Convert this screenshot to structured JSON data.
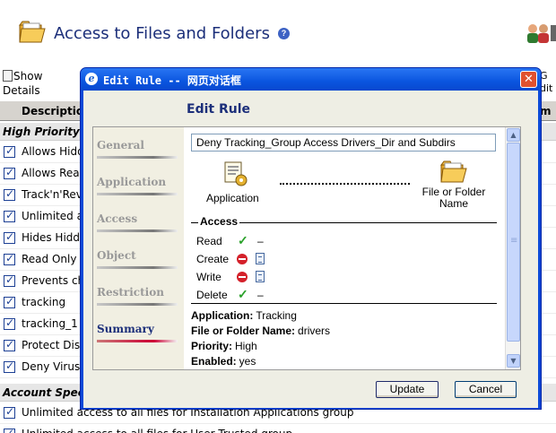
{
  "page": {
    "title": "Access to Files and Folders",
    "toolbar": {
      "show_details_line1": "Show",
      "show_details_line2": "Details",
      "right_edit_line1": "G",
      "right_edit_line2": "dit"
    },
    "columns": {
      "description": "Description",
      "right": "m"
    },
    "groups": [
      {
        "label": "High Priority"
      },
      {
        "label": "Account Speci"
      }
    ],
    "rules": [
      "Allows Hidd",
      "Allows Read",
      "Track'n'Rev",
      "Unlimited a",
      "Hides Hidde",
      "Read Only",
      "Prevents ch",
      "tracking",
      "tracking_1",
      "Protect Disl",
      "Deny Virus"
    ],
    "account_rules": [
      "Unlimited access to all files for Installation Applications group",
      "Unlimited access to all files for User Trusted group"
    ]
  },
  "dialog": {
    "title": "Edit Rule -- 网页对话框",
    "close_label": "✕",
    "heading": "Edit Rule",
    "nav": [
      "General",
      "Application",
      "Access",
      "Object",
      "Restriction",
      "Summary"
    ],
    "active_nav": "Summary",
    "rule_name": "Deny Tracking_Group Access Drivers_Dir and Subdirs",
    "application_label": "Application",
    "folder_label": "File or Folder Name",
    "access_legend": "Access",
    "permissions": [
      {
        "label": "Read",
        "state": "allow",
        "log": "–"
      },
      {
        "label": "Create",
        "state": "deny",
        "log": "log-icon"
      },
      {
        "label": "Write",
        "state": "deny",
        "log": "log-icon"
      },
      {
        "label": "Delete",
        "state": "allow",
        "log": "–"
      }
    ],
    "summary": [
      {
        "key": "Application:",
        "value": "Tracking"
      },
      {
        "key": "File or Folder Name:",
        "value": "drivers"
      },
      {
        "key": "Priority:",
        "value": "High"
      },
      {
        "key": "Enabled:",
        "value": "yes"
      }
    ],
    "buttons": {
      "update": "Update",
      "cancel": "Cancel"
    }
  },
  "colors": {
    "title_bar": "#0a55df",
    "heading": "#1c2f7a",
    "allow": "#2aa12a",
    "deny": "#d4202a",
    "active_nav_bar": "#cc0033"
  }
}
